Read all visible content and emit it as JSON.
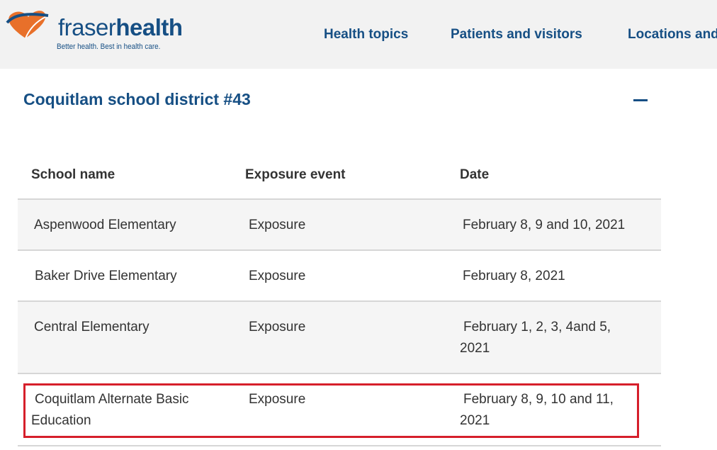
{
  "brand": {
    "name_light": "fraser",
    "name_bold": "health",
    "tagline": "Better health. Best in health care.",
    "logo_icon": "heart-logo-icon",
    "colors": {
      "primary": "#164f84",
      "accent": "#e8702a",
      "highlight": "#d61f2b"
    }
  },
  "nav": {
    "items": [
      {
        "label": "Health topics"
      },
      {
        "label": "Patients and visitors"
      },
      {
        "label": "Locations and"
      }
    ]
  },
  "section": {
    "title": "Coquitlam school district #43",
    "collapse_icon": "minus-icon"
  },
  "table": {
    "headers": [
      "School name",
      "Exposure event",
      "Date"
    ],
    "rows": [
      {
        "school": "Aspenwood Elementary",
        "event": "Exposure",
        "date": "February 8, 9 and 10, 2021"
      },
      {
        "school": "Baker Drive Elementary",
        "event": "Exposure",
        "date": "February 8, 2021"
      },
      {
        "school": "Central Elementary",
        "event": "Exposure",
        "date": "February 1, 2, 3, 4and 5, 2021"
      },
      {
        "school": "Coquitlam Alternate Basic Education",
        "event": "Exposure",
        "date": "February 8, 9, 10 and 11, 2021"
      }
    ]
  }
}
